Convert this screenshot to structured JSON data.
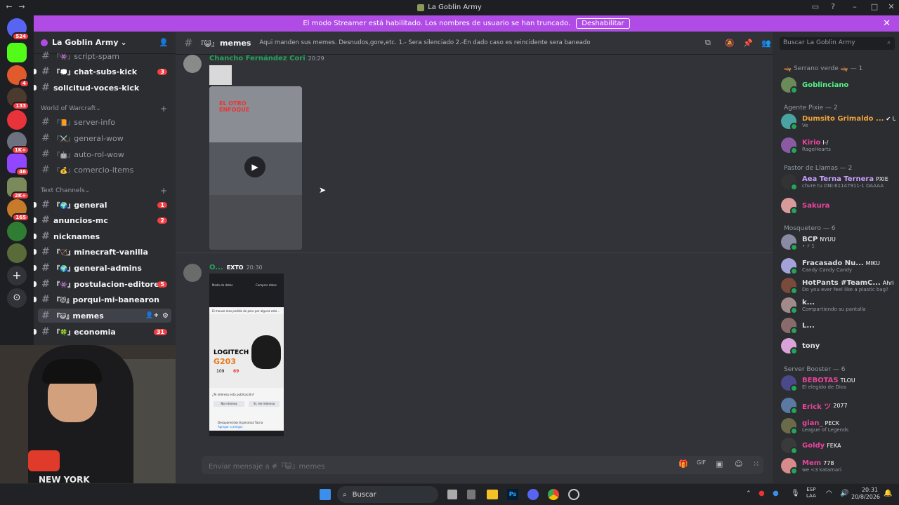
{
  "titlebar": {
    "title": "La Goblin Army"
  },
  "streamer_banner": {
    "text": "El modo Streamer está habilitado. Los nombres de usuario se han truncado.",
    "button": "Deshabilitar"
  },
  "server_badges": [
    "524",
    "4",
    "133",
    "1K+",
    "46",
    "2K+",
    "165"
  ],
  "guild": {
    "name": "La Goblin Army"
  },
  "channels": [
    {
      "label": "script-spam",
      "prefix": "『👾』",
      "state": "read"
    },
    {
      "label": "chat-subs-kick",
      "prefix": "『💭』",
      "state": "unread",
      "badge": "3"
    },
    {
      "label": "solicitud-voces-kick",
      "prefix": "",
      "state": "unread"
    },
    {
      "label": "server-info",
      "prefix": "『📙』",
      "state": "read"
    },
    {
      "label": "general-wow",
      "prefix": "『⚔️』",
      "state": "read"
    },
    {
      "label": "auto-rol-wow",
      "prefix": "『🤖』",
      "state": "read"
    },
    {
      "label": "comercio-items",
      "prefix": "『💰』",
      "state": "read"
    },
    {
      "label": "general",
      "prefix": "『🌍』",
      "state": "unread",
      "badge": "1"
    },
    {
      "label": "anuncios-mc",
      "prefix": "",
      "state": "unread",
      "badge": "2"
    },
    {
      "label": "nicknames",
      "prefix": "",
      "state": "unread"
    },
    {
      "label": "minecraft-vanilla",
      "prefix": "『🏹』",
      "state": "unread"
    },
    {
      "label": "general-admins",
      "prefix": "『🌍』",
      "state": "unread"
    },
    {
      "label": "postulacion-editores",
      "prefix": "『👾』",
      "state": "unread",
      "badge": "5"
    },
    {
      "label": "porqui-mi-banearon",
      "prefix": "『😾』",
      "state": "unread"
    },
    {
      "label": "memes",
      "prefix": "『😺』",
      "state": "active"
    },
    {
      "label": "economia",
      "prefix": "『🍀』",
      "state": "unread",
      "badge": "31"
    }
  ],
  "categories": {
    "wow": "World of Warcraft",
    "text": "Text Channels"
  },
  "chat_header": {
    "channel": "memes",
    "prefix": "『😺』",
    "topic": "Aqui manden sus memes. Desnudos,gore,etc. 1.- Sera silenciado 2.-En dado caso es reincidente sera baneado"
  },
  "search": {
    "placeholder": "Buscar La Goblin Army"
  },
  "messages": [
    {
      "author": "Chancho Fernández Cori",
      "time": "20:29",
      "color": "#23a55a",
      "video_text": "EL OTRO ENFOQUE"
    },
    {
      "author": "O...",
      "tag": "EXTO",
      "time": "20:30",
      "color": "#23a55a",
      "ad": {
        "brand": "LOGITECH",
        "model": "G203",
        "price_old": "109",
        "price_new": "69"
      },
      "phone": {
        "top_left": "Modo de datos",
        "top_right": "Comprar datos",
        "feed_text": "El mouse mas pedido de peru por alguna este...",
        "prompt": "¿Te interesa esta publicación?",
        "no": "No interesa",
        "yes": "Sí, me interesa",
        "contact": "Desaparecidos Esperanza Tacna",
        "contact_sub": "Agregar a amigos"
      }
    }
  ],
  "composer": {
    "placeholder": "Enviar mensaje a #『😺』memes"
  },
  "member_groups": [
    {
      "label": "🛶 Serrano verde 🛶 — 1",
      "members": [
        {
          "name": "Goblinciano",
          "color": "#57f287",
          "status": ""
        }
      ]
    },
    {
      "label": "Agente Pixie — 2",
      "members": [
        {
          "name": "Dumsito Grimaldo ...",
          "color": "#f0a23b",
          "tag": "✔ UC",
          "status": "Ve"
        },
        {
          "name": "Kirio",
          "color": "#eb459e",
          "tag": "I-/",
          "status": "RageHearts"
        }
      ]
    },
    {
      "label": "Pastor de Llamas — 2",
      "members": [
        {
          "name": "Aea Terna Ternera",
          "color": "#c9a0ff",
          "tag": "PXIE",
          "status": "chvre tu DNI:61147911-1 DAAAA"
        },
        {
          "name": "Sakura",
          "color": "#eb459e",
          "tag": "",
          "status": ""
        }
      ]
    },
    {
      "label": "Mosquetero — 6",
      "members": [
        {
          "name": "BCP",
          "color": "#dbdee1",
          "tag": "NYUU",
          "status": "• ⚡ 1"
        },
        {
          "name": "Fracasado Nu...",
          "color": "#dbdee1",
          "tag": "MIKU",
          "status": "Candy Candy Candy"
        },
        {
          "name": "HotPants #TeamC...",
          "color": "#dbdee1",
          "tag": "Ahri",
          "status": "Do you ever feel like a plastic bag?"
        },
        {
          "name": "k...",
          "color": "#dbdee1",
          "tag": "",
          "status": "Compartiendo su pantalla"
        },
        {
          "name": "L...",
          "color": "#dbdee1",
          "tag": "",
          "status": ""
        },
        {
          "name": "tony",
          "color": "#dbdee1",
          "tag": "",
          "status": ""
        }
      ]
    },
    {
      "label": "Server Booster — 6",
      "members": [
        {
          "name": "BEBOTAS",
          "color": "#eb459e",
          "tag": "TLOU",
          "status": "El elegido de Dios"
        },
        {
          "name": "Erick ツ",
          "color": "#eb459e",
          "tag": "2077",
          "status": ""
        },
        {
          "name": "gian_",
          "color": "#eb459e",
          "tag": "PECK",
          "status": "League of Legends"
        },
        {
          "name": "Goldy",
          "color": "#eb459e",
          "tag": "FEKA",
          "status": ""
        },
        {
          "name": "Mem",
          "color": "#eb459e",
          "tag": "778",
          "status": "we <3 katamari"
        }
      ]
    }
  ],
  "taskbar": {
    "search": "Buscar",
    "lang_top": "ESP",
    "lang_bot": "LAA",
    "time": "20:31",
    "date": "20/8/2026"
  },
  "webcam": {
    "shirt_text": "NEW YORK"
  }
}
